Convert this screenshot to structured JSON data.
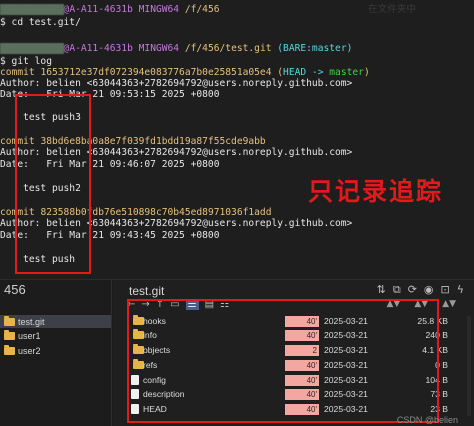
{
  "terminal": {
    "line1": {
      "prefix_blur": "zhongbelien",
      "host": "@A-A11-4631b",
      "mingw": "MINGW64",
      "path": "/f/456"
    },
    "line2": "$ cd test.git/",
    "line3": {
      "prefix_blur": "zhongbelien",
      "host": "@A-A11-4631b",
      "mingw": "MINGW64",
      "path": "/f/456/test.git",
      "branch": "(BARE:master)"
    },
    "line4": "$ git log",
    "commit1": {
      "label": "commit",
      "hash": "1653712e37df072394e083776a7b0e25851a05e4",
      "ref_open": "(",
      "head": "HEAD",
      "arrow": "->",
      "master": "master",
      "ref_close": ")"
    },
    "author1": "Author: belien <63044363+2782694792@users.noreply.github.com>",
    "date1": "Date:   Fri Mar 21 09:53:15 2025 +0800",
    "msg1": "    test push3",
    "commit2": {
      "label": "commit",
      "hash": "38bd6e8ba0a8e7f039fd1bdd19a87f55cde9abb"
    },
    "author2": "Author: belien <63044363+2782694792@users.noreply.github.com>",
    "date2": "Date:   Fri Mar 21 09:46:07 2025 +0800",
    "msg2": "    test push2",
    "commit3": {
      "label": "commit",
      "hash": "823588b0fdb76e510898c70b45ed8971036f1add"
    },
    "author3": "Author: belien <63044363+2782694792@users.noreply.github.com>",
    "date3": "Date:   Fri Mar 21 09:43:45 2025 +0800",
    "msg3": "    test push",
    "bg_right_blur": "在文件夹中"
  },
  "annotation": "只记录追踪",
  "explorer": {
    "left_title": "456",
    "tree": [
      {
        "label": "test.git",
        "selected": true
      },
      {
        "label": "user1",
        "selected": false
      },
      {
        "label": "user2",
        "selected": false
      }
    ],
    "right_title": "test.git",
    "files": [
      {
        "name": "hooks",
        "type": "folder",
        "bar": "40'",
        "date": "2025-03-21",
        "size": "25.8 KB"
      },
      {
        "name": "info",
        "type": "folder",
        "bar": "40'",
        "date": "2025-03-21",
        "size": "240 B"
      },
      {
        "name": "objects",
        "type": "folder",
        "bar": "2",
        "date": "2025-03-21",
        "size": "4.1 KB"
      },
      {
        "name": "refs",
        "type": "folder",
        "bar": "40'",
        "date": "2025-03-21",
        "size": "0 B"
      },
      {
        "name": "config",
        "type": "file",
        "bar": "40'",
        "date": "2025-03-21",
        "size": "104 B"
      },
      {
        "name": "description",
        "type": "file",
        "bar": "40'",
        "date": "2025-03-21",
        "size": "73 B"
      },
      {
        "name": "HEAD",
        "type": "file",
        "bar": "40'",
        "date": "2025-03-21",
        "size": "23 B"
      }
    ],
    "watermark": "CSDN @belien"
  },
  "colors": {
    "accent_red": "#e21a1a",
    "bar_pink": "#f4a7a0",
    "folder": "#e8b44a"
  }
}
